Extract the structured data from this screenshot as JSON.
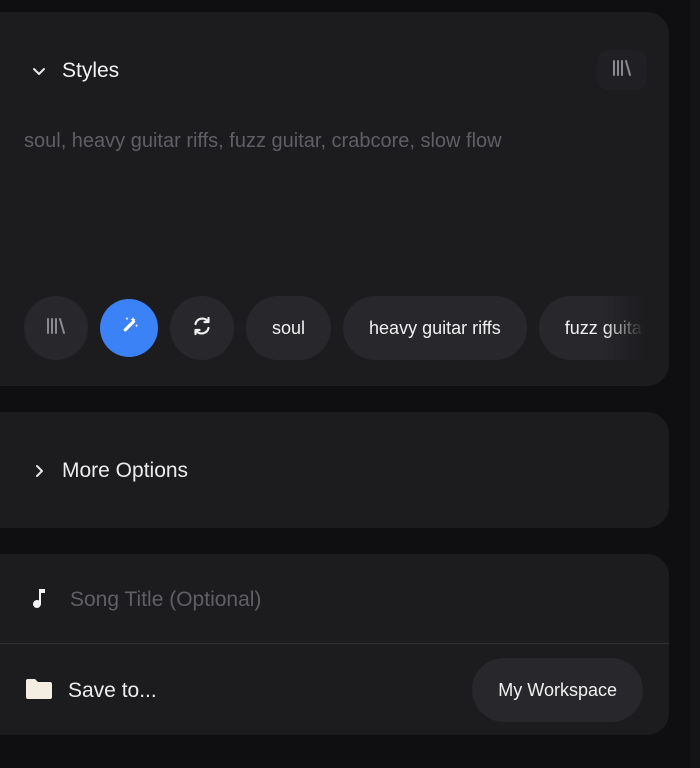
{
  "styles": {
    "header_label": "Styles",
    "text": "soul, heavy guitar riffs, fuzz guitar, crabcore, slow flow",
    "tags": [
      "soul",
      "heavy guitar riffs",
      "fuzz guitar"
    ]
  },
  "more_options": {
    "label": "More Options"
  },
  "song_title": {
    "placeholder": "Song Title (Optional)",
    "value": ""
  },
  "save": {
    "label": "Save to...",
    "workspace": "My Workspace"
  },
  "colors": {
    "accent": "#3b82f6",
    "card": "#1c1c1f",
    "chip": "#28282c",
    "background": "#0f0f11"
  },
  "icons": [
    "chevron-down-icon",
    "library-icon",
    "magic-wand-icon",
    "refresh-icon",
    "chevron-right-icon",
    "music-note-icon",
    "folder-icon"
  ]
}
